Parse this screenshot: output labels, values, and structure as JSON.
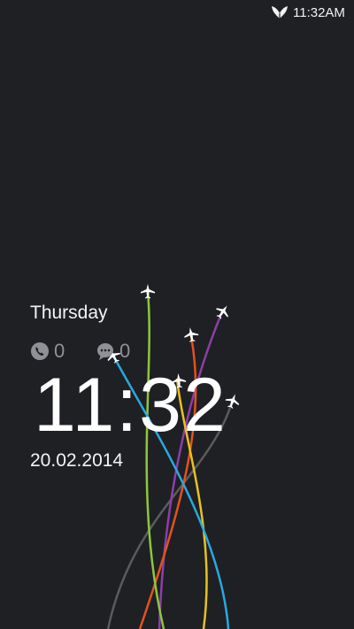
{
  "status_bar": {
    "time": "11:32AM",
    "icon": "leaf-butterfly-icon"
  },
  "lockscreen": {
    "day": "Thursday",
    "missed_calls": "0",
    "unread_messages": "0",
    "time": "11:32",
    "date": "20.02.2014"
  },
  "wallpaper": {
    "name": "airplane-trails",
    "background": "#1f2024",
    "trail_colors": [
      "#8dc63f",
      "#29a8e0",
      "#e8c21f",
      "#e0531f",
      "#8b3fa8",
      "#5b5c60"
    ]
  },
  "colors": {
    "text_primary": "#ffffff",
    "text_muted": "#8f9196"
  }
}
